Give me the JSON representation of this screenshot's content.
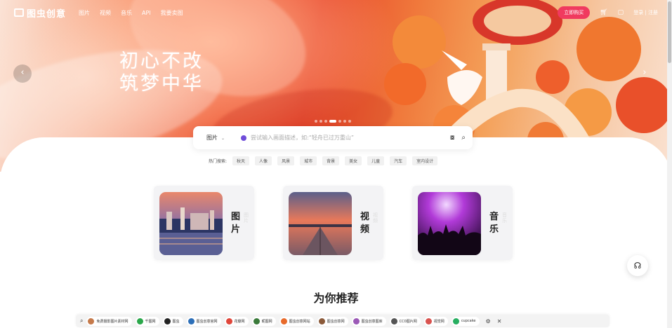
{
  "brand": {
    "name": "图虫创意"
  },
  "nav": {
    "links": [
      "图片",
      "视频",
      "音乐",
      "API",
      "我要卖图"
    ],
    "buy_label": "立即购买",
    "cart_icon": "cart-icon",
    "message_icon": "message-icon",
    "login_label": "登录 | 注册"
  },
  "hero": {
    "title_line1": "初心不改",
    "title_line2": "筑梦中华",
    "prev_icon": "chevron-left-icon",
    "next_icon": "chevron-right-icon",
    "active_slide": 3,
    "slide_count": 7
  },
  "search": {
    "type": "图片",
    "placeholder": "尝试输入画面描述，如:“轻舟已过万重山”",
    "camera_icon": "camera-icon",
    "search_icon": "search-icon"
  },
  "hot": {
    "label": "热门搜索:",
    "tags": [
      "秋天",
      "人像",
      "风景",
      "城市",
      "背景",
      "美女",
      "儿童",
      "汽车",
      "室内设计"
    ]
  },
  "categories": [
    {
      "title": "图片",
      "ghost": "图片"
    },
    {
      "title": "视频",
      "ghost": "视频"
    },
    {
      "title": "音乐",
      "ghost": "音乐"
    }
  ],
  "recommend": {
    "title": "为你推荐"
  },
  "bookmarks": [
    {
      "label": "免费摄影图片素材网",
      "color": "#c57a4b"
    },
    {
      "label": "千图网",
      "color": "#2aa74a"
    },
    {
      "label": "图虫",
      "color": "#222222"
    },
    {
      "label": "图虫创意官网",
      "color": "#2c6fb8"
    },
    {
      "label": "花瓣网",
      "color": "#e0463a"
    },
    {
      "label": "昵图网",
      "color": "#3a7a3a"
    },
    {
      "label": "图虫创意网站",
      "color": "#e86a2a"
    },
    {
      "label": "图虫创意网",
      "color": "#8b5a3a"
    },
    {
      "label": "图虫创意图库",
      "color": "#9b59b6"
    },
    {
      "label": "CC0图片网",
      "color": "#555555"
    },
    {
      "label": "视觉网",
      "color": "#d9534f"
    },
    {
      "label": "cupcake",
      "color": "#27ae60"
    }
  ],
  "colors": {
    "accent": "#f03a5f",
    "hero_red": "#e8472b"
  }
}
